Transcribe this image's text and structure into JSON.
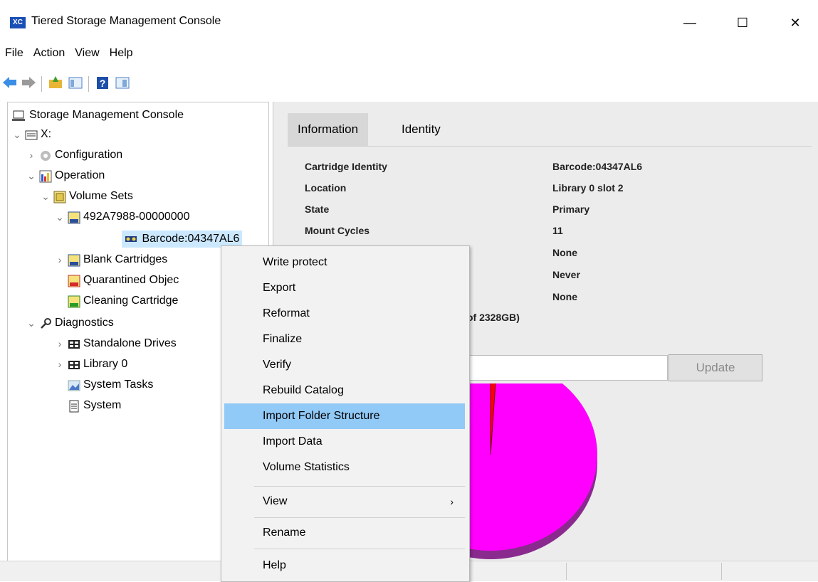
{
  "window": {
    "icon_text": "XC",
    "title": "Tiered Storage Management Console",
    "minimize": "—",
    "maximize": "☐",
    "close": "✕"
  },
  "menu": [
    "File",
    "Action",
    "View",
    "Help"
  ],
  "tree": {
    "root": "Storage Management Console",
    "drive": "X:",
    "configuration": "Configuration",
    "operation": "Operation",
    "volume_sets": "Volume Sets",
    "volume_set_id": "492A7988-00000000",
    "selected_cartridge": "Barcode:04347AL6",
    "blank_cartridges": "Blank Cartridges",
    "quarantined": "Quarantined Objec",
    "cleaning": "Cleaning Cartridge",
    "diagnostics": "Diagnostics",
    "standalone_drives": "Standalone Drives",
    "library0": "Library 0",
    "system_tasks": "System Tasks",
    "system": "System"
  },
  "tabs": [
    "Information",
    "Identity"
  ],
  "info": {
    "rows": [
      {
        "key": "Cartridge Identity",
        "value": "Barcode:04347AL6"
      },
      {
        "key": "Location",
        "value": "Library 0 slot 2"
      },
      {
        "key": "State",
        "value": "Primary"
      },
      {
        "key": "Mount Cycles",
        "value": "11"
      },
      {
        "key": "",
        "value": "None"
      },
      {
        "key": "",
        "value": "Never"
      },
      {
        "key": "",
        "value": "None"
      }
    ],
    "capacity_text": "of 2328GB)",
    "update_label": "Update",
    "used_fraction": 0.01
  },
  "colors": {
    "pie_main": "#ff00ff",
    "pie_side": "#8a2a8f",
    "pie_used": "#ff0000",
    "highlight": "#91c9f7"
  },
  "context_menu": {
    "items": [
      "Write protect",
      "Export",
      "Reformat",
      "Finalize",
      "Verify",
      "Rebuild Catalog",
      "Import Folder Structure",
      "Import Data",
      "Volume Statistics"
    ],
    "view": "View",
    "rename": "Rename",
    "help": "Help",
    "highlighted": "Import Folder Structure"
  }
}
